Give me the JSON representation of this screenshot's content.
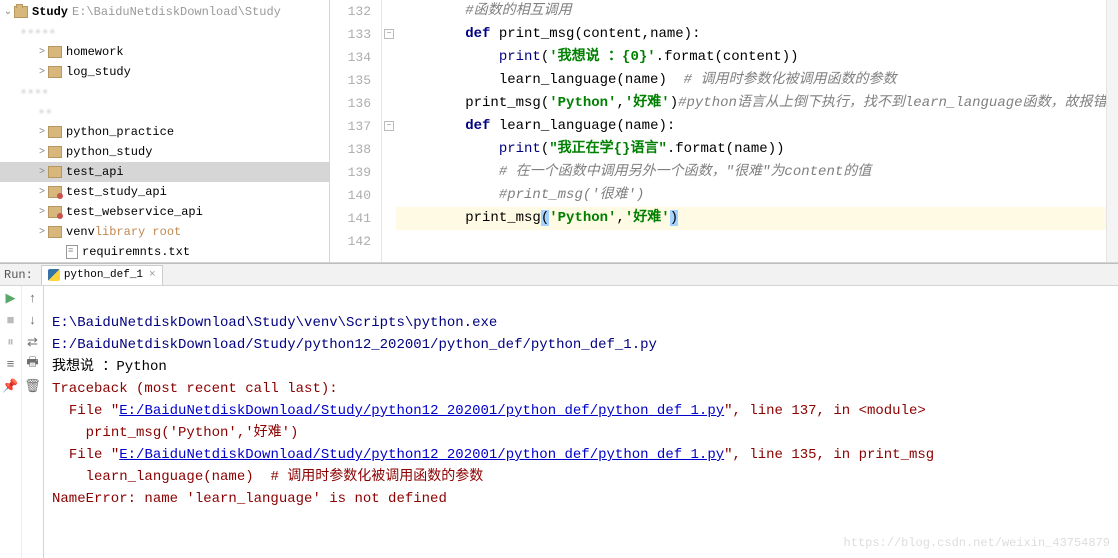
{
  "sidebar": {
    "root_name": "Study",
    "root_path": "E:\\BaiduNetdiskDownload\\Study",
    "items": [
      {
        "label": "homework",
        "indent": 2,
        "twisty": ">",
        "icon": "folder"
      },
      {
        "label": "log_study",
        "indent": 2,
        "twisty": ">",
        "icon": "folder"
      },
      {
        "label": "python_practice",
        "indent": 2,
        "twisty": ">",
        "icon": "folder"
      },
      {
        "label": "python_study",
        "indent": 2,
        "twisty": ">",
        "icon": "folder"
      },
      {
        "label": "test_api",
        "indent": 2,
        "twisty": ">",
        "icon": "folder",
        "selected": true
      },
      {
        "label": "test_study_api",
        "indent": 2,
        "twisty": ">",
        "icon": "folder-dot"
      },
      {
        "label": "test_webservice_api",
        "indent": 2,
        "twisty": ">",
        "icon": "folder-dot"
      },
      {
        "label": "venv",
        "suffix": "library root",
        "indent": 2,
        "twisty": ">",
        "icon": "folder",
        "lib": true
      },
      {
        "label": "requiremnts.txt",
        "indent": 3,
        "twisty": "",
        "icon": "file"
      }
    ]
  },
  "editor": {
    "lines": [
      {
        "n": 132,
        "indent": 2,
        "html": "<span class='cmt'>#函数的相互调用</span>"
      },
      {
        "n": 133,
        "indent": 2,
        "fold": "-",
        "html": "<span class='kw'>def</span> <span class='fn-def'>print_msg</span>(content,name):"
      },
      {
        "n": 134,
        "indent": 3,
        "html": "<span class='builtin'>print</span>(<span class='str'>'</span><span class='str-cn'>我想说 ：{0}</span><span class='str'>'</span>.format(content))"
      },
      {
        "n": 135,
        "indent": 3,
        "html": "learn_language(name)  <span class='cmt'># 调用时参数化被调用函数的参数</span>"
      },
      {
        "n": 136,
        "indent": 2,
        "html": "<span class='call'>print_msg</span>(<span class='str'>'Python'</span>,<span class='str'>'好难'</span>)<span class='cmt'>#python</span><span class='cmt'>语言从上倒下执行，找不到</span><span class='cmt'>learn_language</span><span class='cmt'>函数，故报错</span>"
      },
      {
        "n": 137,
        "indent": 2,
        "fold": "-",
        "html": "<span class='kw'>def</span> <span class='fn-def'>learn_language</span>(name):"
      },
      {
        "n": 138,
        "indent": 3,
        "html": "<span class='builtin'>print</span>(<span class='str'>\"</span><span class='str-cn'>我正在学{}语言</span><span class='str'>\"</span>.format(name))"
      },
      {
        "n": 139,
        "indent": 3,
        "html": "<span class='cmt'># 在一个函数中调用另外一个函数，\"很难\"为content的值</span>"
      },
      {
        "n": 140,
        "indent": 3,
        "html": "<span class='cmt'>#print_msg('很难')</span>"
      },
      {
        "n": 141,
        "indent": 2,
        "hl": true,
        "html": "<span class='call'>print_msg</span><span class='caret-sel'>(</span><span class='str'>'Python'</span>,<span class='str'>'好难'</span><span class='caret-sel'>)</span>"
      },
      {
        "n": 142,
        "indent": 2,
        "html": ""
      }
    ]
  },
  "run": {
    "label": "Run:",
    "tab": "python_def_1",
    "cmd": "E:\\BaiduNetdiskDownload\\Study\\venv\\Scripts\\python.exe E:/BaiduNetdiskDownload/Study/python12_202001/python_def/python_def_1.py",
    "out1": "我想说 ：Python",
    "tb_head": "Traceback (most recent call last):",
    "tb_l1a": "  File \"",
    "tb_l1_link": "E:/BaiduNetdiskDownload/Study/python12 202001/python def/python def 1.py",
    "tb_l1b": "\", line 137, in <module>",
    "tb_l2": "    print_msg('Python','好难')",
    "tb_l3a": "  File \"",
    "tb_l3_link": "E:/BaiduNetdiskDownload/Study/python12 202001/python def/python def 1.py",
    "tb_l3b": "\", line 135, in print_msg",
    "tb_l4": "    learn_language(name)  # 调用时参数化被调用函数的参数",
    "tb_err": "NameError: name 'learn_language' is not defined"
  },
  "watermark": "https://blog.csdn.net/weixin_43754879"
}
